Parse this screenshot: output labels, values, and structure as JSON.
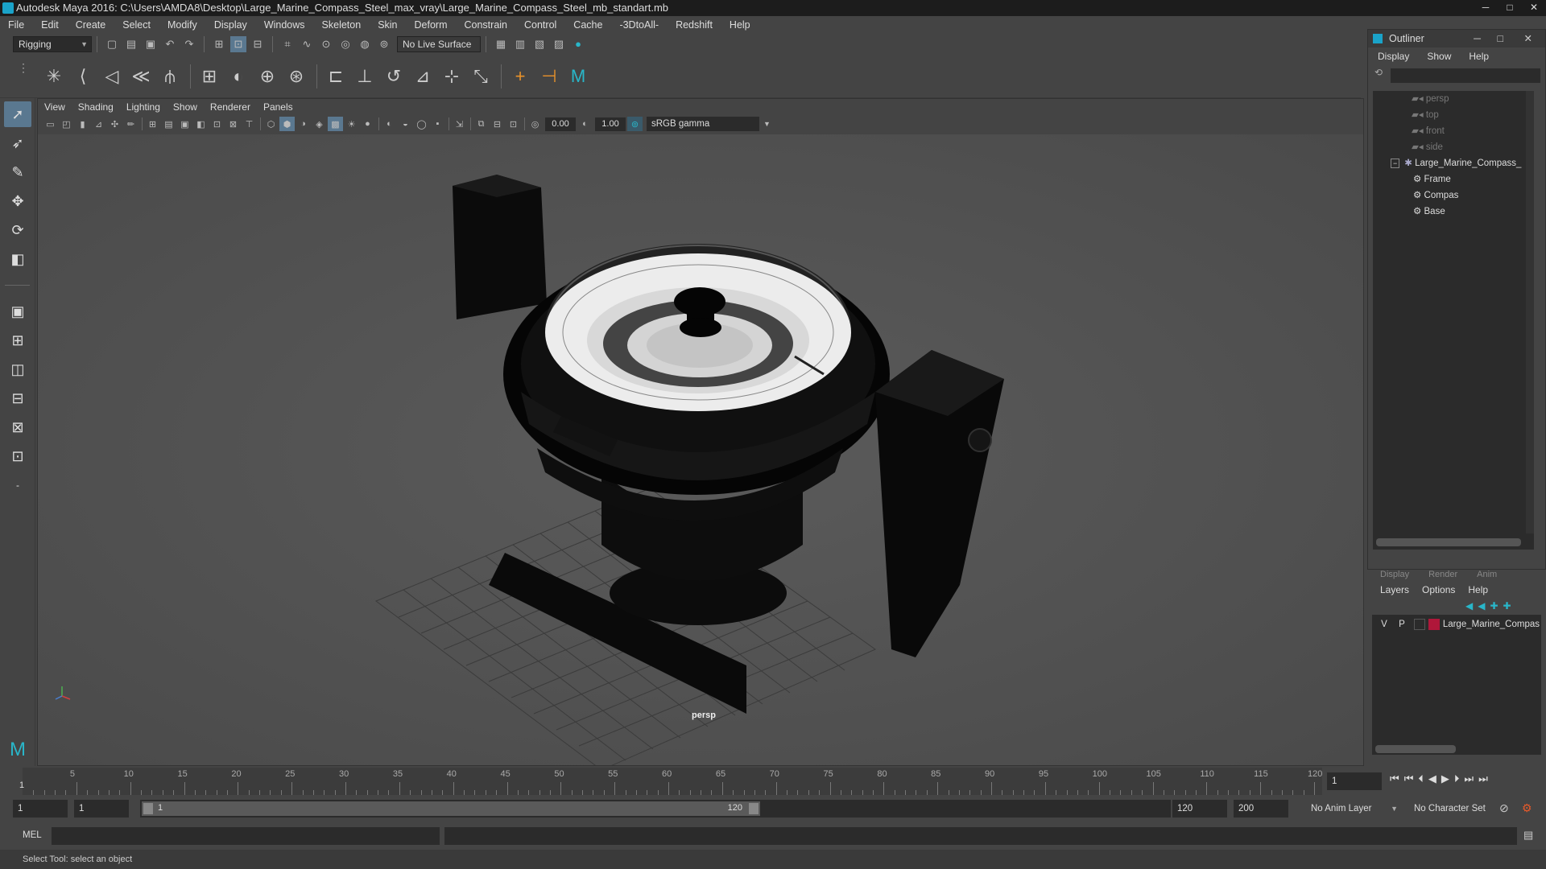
{
  "window": {
    "title": "Autodesk Maya 2016: C:\\Users\\AMDA8\\Desktop\\Large_Marine_Compass_Steel_max_vray\\Large_Marine_Compass_Steel_mb_standart.mb"
  },
  "menubar": [
    "File",
    "Edit",
    "Create",
    "Select",
    "Modify",
    "Display",
    "Windows",
    "Skeleton",
    "Skin",
    "Deform",
    "Constrain",
    "Control",
    "Cache",
    "-3DtoAll-",
    "Redshift",
    "Help"
  ],
  "status": {
    "mode": "Rigging",
    "live_surface": "No Live Surface"
  },
  "panel": {
    "menu": [
      "View",
      "Shading",
      "Lighting",
      "Show",
      "Renderer",
      "Panels"
    ],
    "exposure": "0.00",
    "gamma_value": "1.00",
    "color_space": "sRGB gamma",
    "camera_label": "persp"
  },
  "outliner": {
    "title": "Outliner",
    "menu": [
      "Display",
      "Show",
      "Help"
    ],
    "items": [
      {
        "label": "persp",
        "type": "camera"
      },
      {
        "label": "top",
        "type": "camera"
      },
      {
        "label": "front",
        "type": "camera"
      },
      {
        "label": "side",
        "type": "camera"
      },
      {
        "label": "Large_Marine_Compass_",
        "type": "group"
      },
      {
        "label": "Frame",
        "type": "mesh"
      },
      {
        "label": "Compas",
        "type": "mesh"
      },
      {
        "label": "Base",
        "type": "mesh"
      }
    ]
  },
  "layers": {
    "tabs": [
      "Display",
      "Render",
      "Anim"
    ],
    "menu": [
      "Layers",
      "Options",
      "Help"
    ],
    "row": {
      "v": "V",
      "p": "P",
      "name": "Large_Marine_Compas",
      "color": "#b0173a"
    }
  },
  "timeline": {
    "ticks": [
      "5",
      "10",
      "15",
      "20",
      "25",
      "30",
      "35",
      "40",
      "45",
      "50",
      "55",
      "60",
      "65",
      "70",
      "75",
      "80",
      "85",
      "90",
      "95",
      "100",
      "105",
      "110",
      "115",
      "120"
    ],
    "current_start": "1",
    "current_frame": "1"
  },
  "range": {
    "start": "1",
    "playback_start": "1",
    "slider_start": "1",
    "slider_end": "120",
    "playback_end": "120",
    "end": "200",
    "anim_layer": "No Anim Layer",
    "character_set": "No Character Set"
  },
  "cmd": {
    "label": "MEL"
  },
  "help": {
    "text": "Select Tool: select an object"
  },
  "colors": {
    "accent": "#1aa3c9",
    "layer_color": "#b0173a"
  }
}
